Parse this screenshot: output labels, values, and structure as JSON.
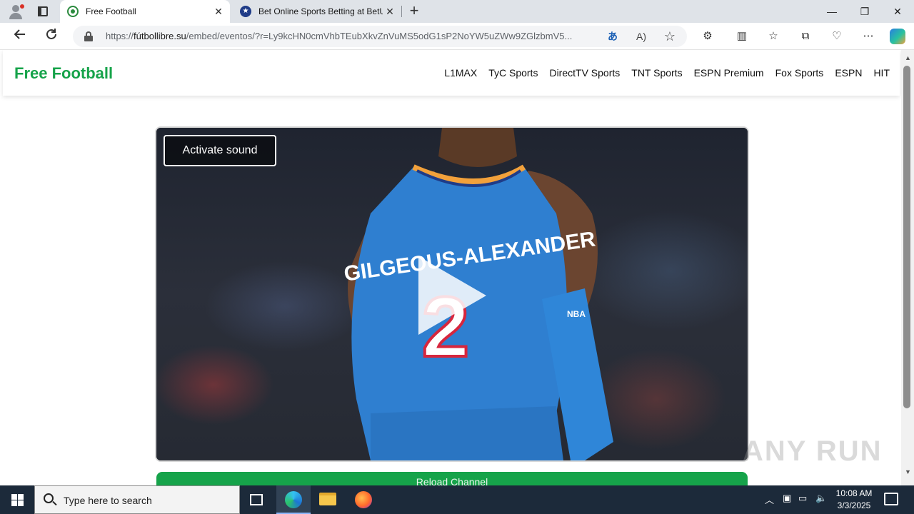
{
  "browser": {
    "tabs": [
      {
        "title": "Free Football",
        "active": true
      },
      {
        "title": "Bet Online Sports Betting at BetU",
        "active": false
      }
    ],
    "new_tab": "+",
    "window_controls": {
      "minimize": "—",
      "restore": "❐",
      "close": "✕"
    },
    "url_prefix": "https://",
    "url_host": "fútbollibre.su",
    "url_rest": "/embed/eventos/?r=Ly9kcHN0cmVhbTEubXkvZnVuMS5odG1sP2NoYW5uZWw9ZGlzbmV5...",
    "icons": {
      "back": "back-arrow-icon",
      "refresh": "refresh-icon",
      "lock": "lock-icon",
      "translate": "translate-icon",
      "read_aloud": "read-aloud-icon",
      "favorite": "star-icon",
      "extensions": "puzzle-icon",
      "split": "split-screen-icon",
      "favorites": "favorites-icon",
      "collections": "collections-icon",
      "performance": "heartbeat-icon",
      "more": "more-icon",
      "copilot": "copilot-icon"
    }
  },
  "site": {
    "brand": "Free Football",
    "nav": [
      "L1MAX",
      "TyC Sports",
      "DirectTV Sports",
      "TNT Sports",
      "ESPN Premium",
      "Fox Sports",
      "ESPN",
      "HIT"
    ],
    "player": {
      "activate_sound": "Activate sound",
      "jersey_name": "GILGEOUS-ALEXANDER",
      "jersey_number": "2"
    },
    "reload_button": "Reload Channel",
    "watermark": "ANY RUN"
  },
  "taskbar": {
    "search_placeholder": "Type here to search",
    "time": "10:08 AM",
    "date": "3/3/2025"
  },
  "colors": {
    "brand_green": "#16a34a",
    "jersey_blue": "#2f7fd0",
    "taskbar": "#1c2a3a"
  }
}
